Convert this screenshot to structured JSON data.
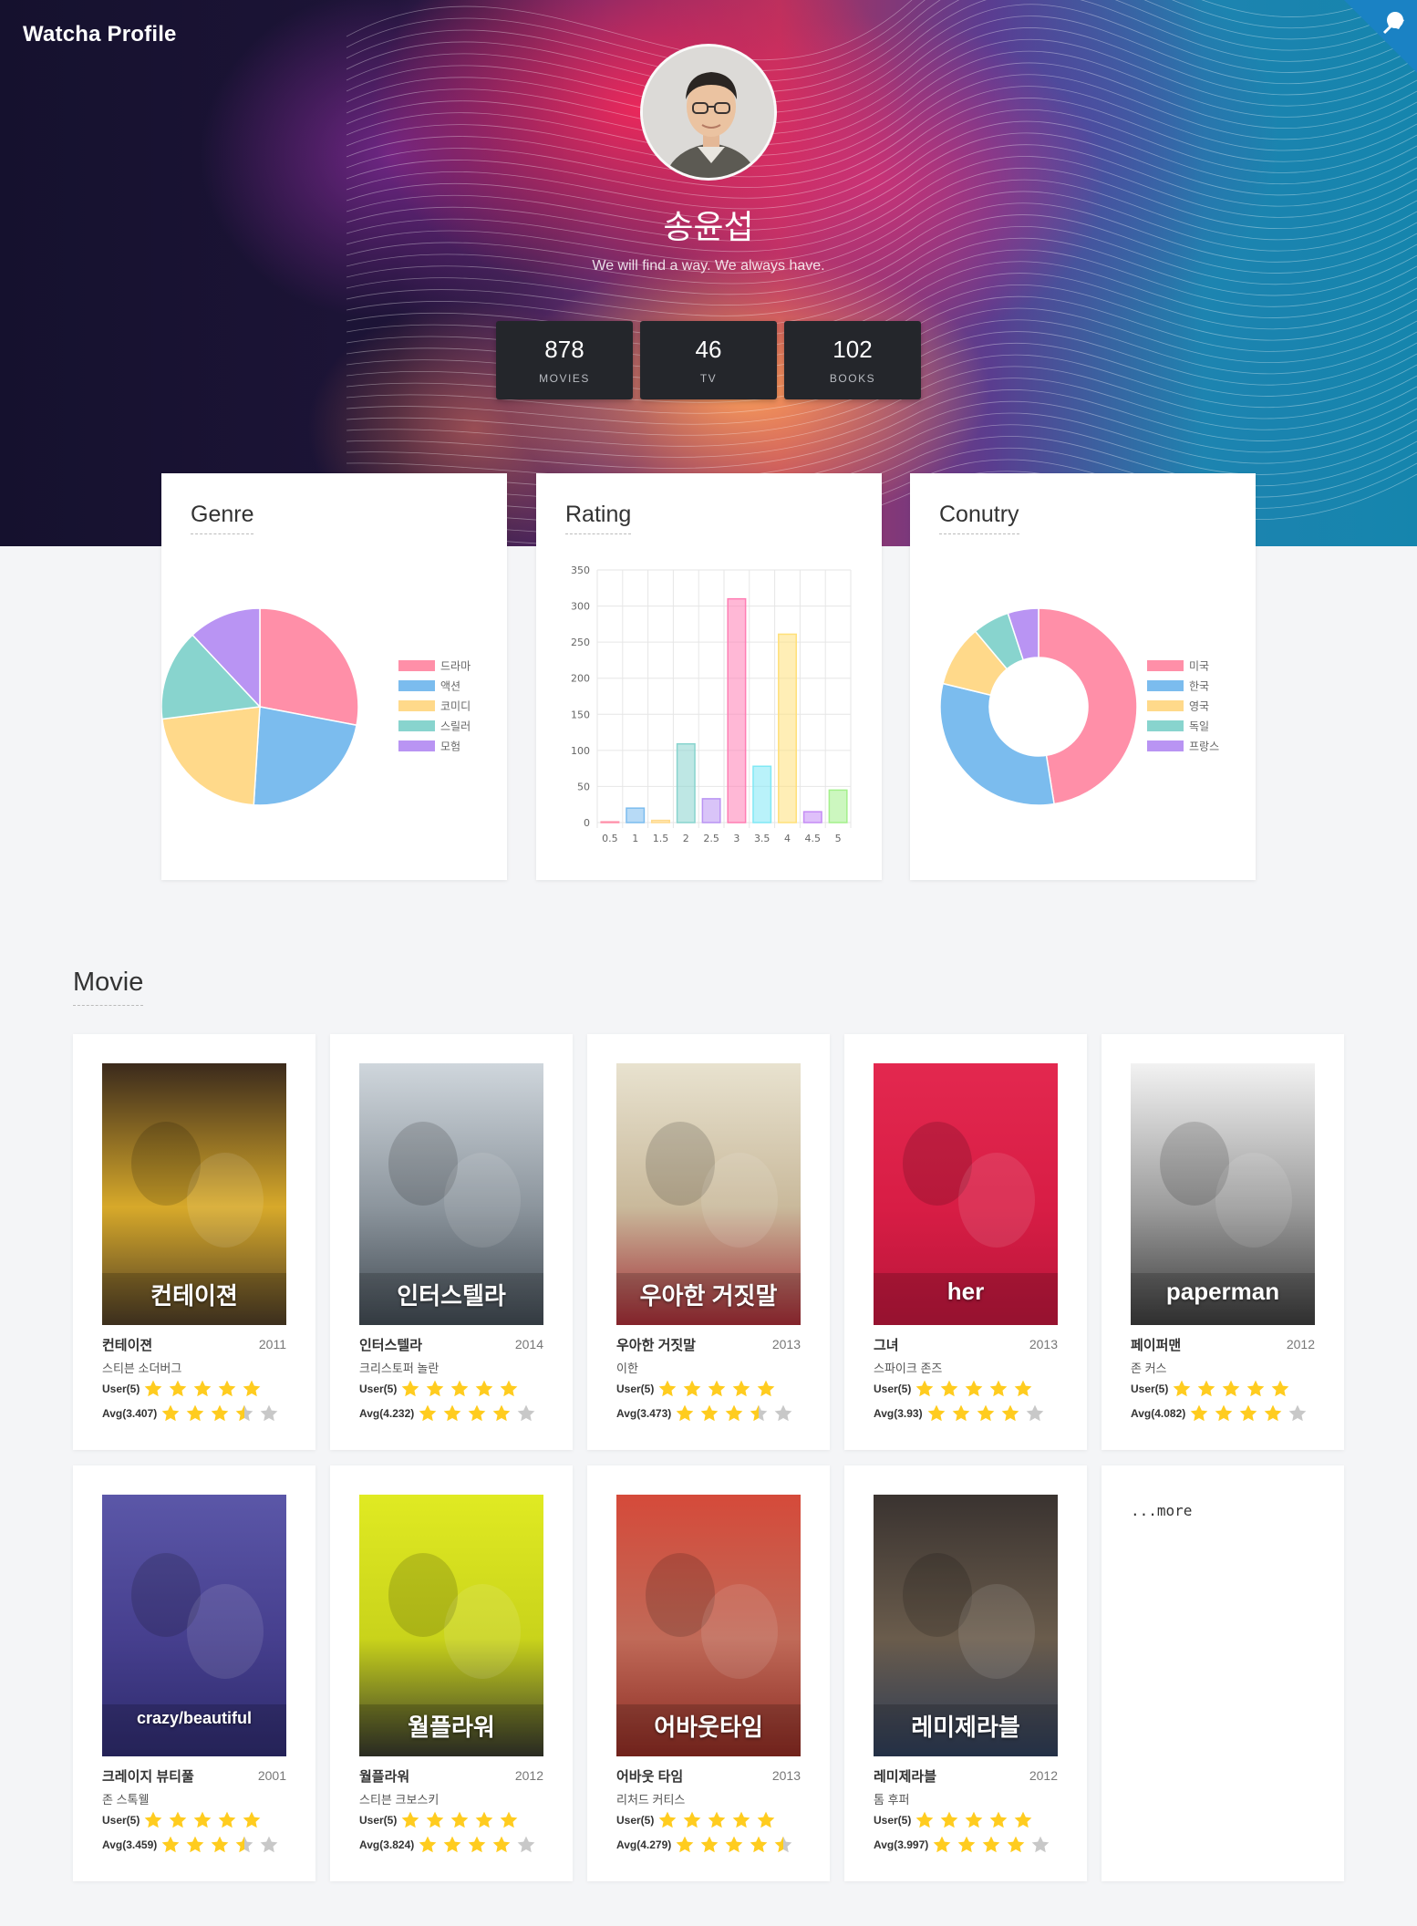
{
  "brand": "Watcha Profile",
  "profile": {
    "name": "송윤섭",
    "motto": "We will find a way. We always have."
  },
  "stats": [
    {
      "value": "878",
      "label": "MOVIES"
    },
    {
      "value": "46",
      "label": "TV"
    },
    {
      "value": "102",
      "label": "BOOKS"
    }
  ],
  "charts": {
    "genre": {
      "title": "Genre"
    },
    "rating": {
      "title": "Rating"
    },
    "country": {
      "title": "Conutry"
    }
  },
  "chart_data": [
    {
      "type": "pie",
      "title": "Genre",
      "labels": [
        "드라마",
        "액션",
        "코미디",
        "스릴러",
        "모험"
      ],
      "values": [
        28,
        23,
        22,
        15,
        12
      ],
      "colors": [
        "#ff8fa8",
        "#7bbcee",
        "#ffd98a",
        "#88d4ce",
        "#b994f3"
      ],
      "legend": "right"
    },
    {
      "type": "bar",
      "title": "Rating",
      "categories": [
        "0.5",
        "1",
        "1.5",
        "2",
        "2.5",
        "3",
        "3.5",
        "4",
        "4.5",
        "5"
      ],
      "values": [
        1,
        20,
        3,
        109,
        33,
        310,
        78,
        261,
        15,
        45
      ],
      "colors": [
        "#ff8fa8",
        "#7bbcee",
        "#ffd98a",
        "#88d4ce",
        "#b994f3",
        "#ff7eb4",
        "#7fe8f5",
        "#ffe07a",
        "#c58cf5",
        "#a3f08a"
      ],
      "ylim": [
        0,
        350
      ],
      "yticks": [
        "0",
        "50",
        "100",
        "150",
        "200",
        "250",
        "300",
        "350"
      ],
      "grid": true
    },
    {
      "type": "doughnut",
      "title": "Conutry",
      "labels": [
        "미국",
        "한국",
        "영국",
        "독일",
        "프랑스"
      ],
      "values": [
        47,
        31,
        10,
        6,
        5
      ],
      "colors": [
        "#ff8fa8",
        "#7bbcee",
        "#ffd98a",
        "#88d4ce",
        "#b994f3"
      ],
      "legend": "right"
    }
  ],
  "movies_section": {
    "title": "Movie"
  },
  "user_label": "User(5)",
  "movies": [
    {
      "title": "컨테이젼",
      "year": "2011",
      "director": "스티븐 소더버그",
      "avg_label": "Avg(3.407)",
      "user": 5,
      "avg": 3.407,
      "poster_text": "컨테이젼",
      "poster_colors": [
        "#3b2a1c",
        "#d7a92a",
        "#4a3a24"
      ]
    },
    {
      "title": "인터스텔라",
      "year": "2014",
      "director": "크리스토퍼 놀란",
      "avg_label": "Avg(4.232)",
      "user": 5,
      "avg": 4.232,
      "poster_text": "인터스텔라",
      "poster_colors": [
        "#cfd6dc",
        "#8c959d",
        "#3f4850"
      ]
    },
    {
      "title": "우아한 거짓말",
      "year": "2013",
      "director": "이한",
      "avg_label": "Avg(3.473)",
      "user": 5,
      "avg": 3.473,
      "poster_text": "우아한 거짓말",
      "poster_colors": [
        "#e8e2cf",
        "#c9b99b",
        "#a12c35"
      ]
    },
    {
      "title": "그녀",
      "year": "2013",
      "director": "스파이크 존즈",
      "avg_label": "Avg(3.93)",
      "user": 5,
      "avg": 3.93,
      "poster_text": "her",
      "poster_colors": [
        "#e3284f",
        "#d81d45",
        "#b8163a"
      ]
    },
    {
      "title": "페이퍼맨",
      "year": "2012",
      "director": "존 커스",
      "avg_label": "Avg(4.082)",
      "user": 5,
      "avg": 4.082,
      "poster_text": "paperman",
      "poster_colors": [
        "#f2f2f2",
        "#9c9c9c",
        "#3a3a3a"
      ]
    },
    {
      "title": "크레이지 뷰티풀",
      "year": "2001",
      "director": "존 스톡웰",
      "avg_label": "Avg(3.459)",
      "user": 5,
      "avg": 3.459,
      "poster_text": "crazy/beautiful",
      "poster_colors": [
        "#5b57a8",
        "#463f8e",
        "#2d2a6b"
      ]
    },
    {
      "title": "월플라워",
      "year": "2012",
      "director": "스티븐 크보스키",
      "avg_label": "Avg(3.824)",
      "user": 5,
      "avg": 3.824,
      "poster_text": "월플라워",
      "poster_colors": [
        "#e0ea22",
        "#c9d31b",
        "#33352a"
      ]
    },
    {
      "title": "어바웃 타임",
      "year": "2013",
      "director": "리처드 커티스",
      "avg_label": "Avg(4.279)",
      "user": 5,
      "avg": 4.279,
      "poster_text": "어바웃타임",
      "poster_colors": [
        "#d54a3a",
        "#c06a58",
        "#8a2a22"
      ]
    },
    {
      "title": "레미제라블",
      "year": "2012",
      "director": "톰 후퍼",
      "avg_label": "Avg(3.997)",
      "user": 5,
      "avg": 3.997,
      "poster_text": "레미제라블",
      "poster_colors": [
        "#3a3330",
        "#6a5c4c",
        "#2c3b56"
      ]
    }
  ],
  "more": {
    "label": "...more"
  },
  "colors": {
    "star_on": "#ffcc1f",
    "star_off": "#c8c8c8",
    "stat_bg": "#24262b"
  }
}
